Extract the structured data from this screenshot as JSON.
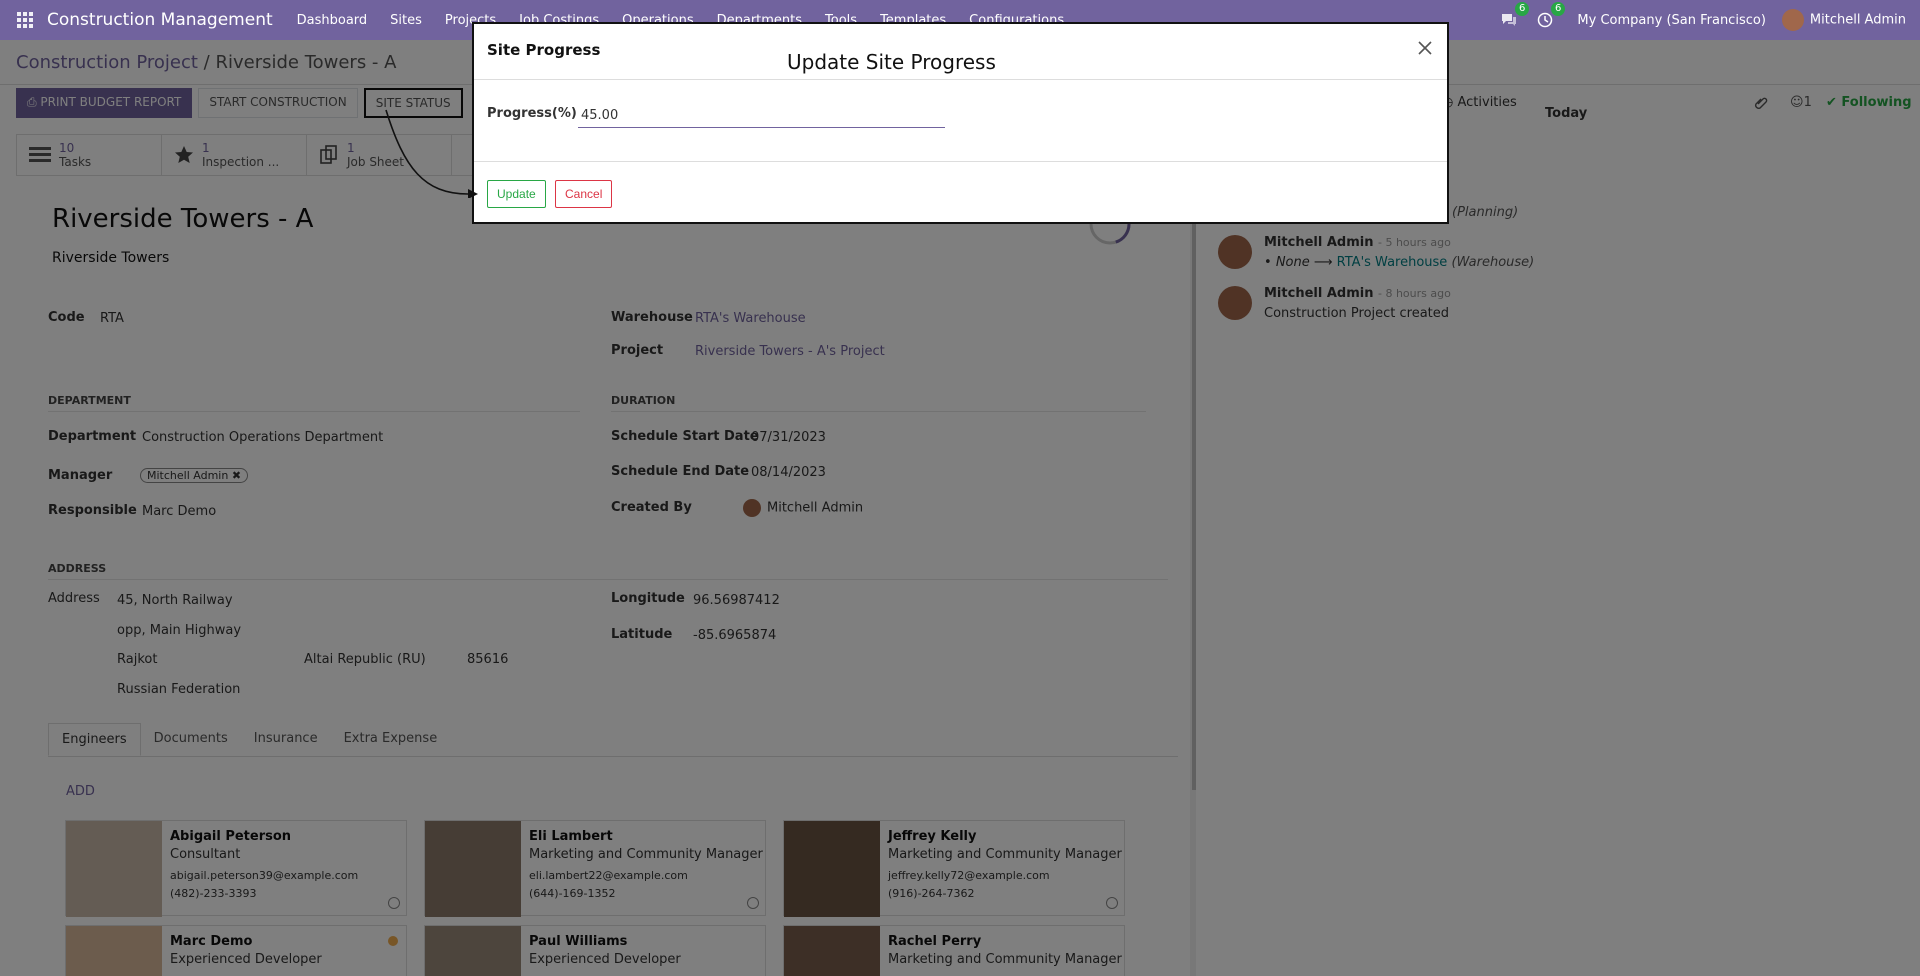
{
  "navbar": {
    "brand": "Construction Management",
    "menu": [
      "Dashboard",
      "Sites",
      "Projects",
      "Job Costings",
      "Operations",
      "Departments",
      "Tools",
      "Templates",
      "Configurations"
    ],
    "chat_count": "6",
    "activity_count": "6",
    "company": "My Company (San Francisco)",
    "user": "Mitchell Admin"
  },
  "breadcrumb": {
    "parent": "Construction Project",
    "current": "Riverside Towers - A"
  },
  "buttons": {
    "print": "PRINT BUDGET REPORT",
    "start": "START CONSTRUCTION",
    "status": "SITE STATUS"
  },
  "stats": [
    {
      "num": "10",
      "label": "Tasks"
    },
    {
      "num": "1",
      "label": "Inspection ..."
    },
    {
      "num": "1",
      "label": "Job Sheet"
    }
  ],
  "record": {
    "title": "Riverside Towers - A",
    "subtitle": "Riverside Towers",
    "code_label": "Code",
    "code": "RTA",
    "warehouse_label": "Warehouse",
    "warehouse": "RTA's Warehouse",
    "project_label": "Project",
    "project": "Riverside Towers - A's Project",
    "progress_fraction": 0.45
  },
  "department": {
    "section": "DEPARTMENT",
    "dept_label": "Department",
    "dept": "Construction Operations Department",
    "manager_label": "Manager",
    "manager": "Mitchell Admin",
    "resp_label": "Responsible",
    "resp": "Marc Demo"
  },
  "duration": {
    "section": "DURATION",
    "start_label": "Schedule Start Date",
    "start": "07/31/2023",
    "end_label": "Schedule End Date",
    "end": "08/14/2023",
    "created_label": "Created By",
    "created": "Mitchell Admin"
  },
  "address": {
    "section": "ADDRESS",
    "label": "Address",
    "line1": "45, North Railway",
    "line2": "opp, Main Highway",
    "city": "Rajkot",
    "state": "Altai Republic (RU)",
    "zip": "85616",
    "country": "Russian Federation",
    "lon_label": "Longitude",
    "lon": "96.56987412",
    "lat_label": "Latitude",
    "lat": "-85.6965874"
  },
  "tabs": [
    "Engineers",
    "Documents",
    "Insurance",
    "Extra Expense"
  ],
  "add": "ADD",
  "engineers": [
    {
      "name": "Abigail Peterson",
      "job": "Consultant",
      "email": "abigail.peterson39@example.com",
      "phone": "(482)-233-3393"
    },
    {
      "name": "Eli Lambert",
      "job": "Marketing and Community Manager",
      "email": "eli.lambert22@example.com",
      "phone": "(644)-169-1352"
    },
    {
      "name": "Jeffrey Kelly",
      "job": "Marketing and Community Manager",
      "email": "jeffrey.kelly72@example.com",
      "phone": "(916)-264-7362"
    },
    {
      "name": "Marc Demo",
      "job": "Experienced Developer"
    },
    {
      "name": "Paul Williams",
      "job": "Experienced Developer"
    },
    {
      "name": "Rachel Perry",
      "job": "Marketing and Community Manager"
    }
  ],
  "chatter": {
    "activities": "Activities",
    "followers": "1",
    "following": "Following",
    "today": "Today",
    "m0_text": "(Planning)",
    "m1_author": "Mitchell Admin",
    "m1_time": "- 5 hours ago",
    "m1_old": "None",
    "m1_new": "RTA's Warehouse",
    "m1_field": "(Warehouse)",
    "m2_author": "Mitchell Admin",
    "m2_time": "- 8 hours ago",
    "m2_text": "Construction Project created"
  },
  "modal": {
    "title": "Site Progress",
    "annotation": "Update Site Progress",
    "progress_label": "Progress(%)",
    "progress_value": "45.00",
    "update": "Update",
    "cancel": "Cancel"
  }
}
